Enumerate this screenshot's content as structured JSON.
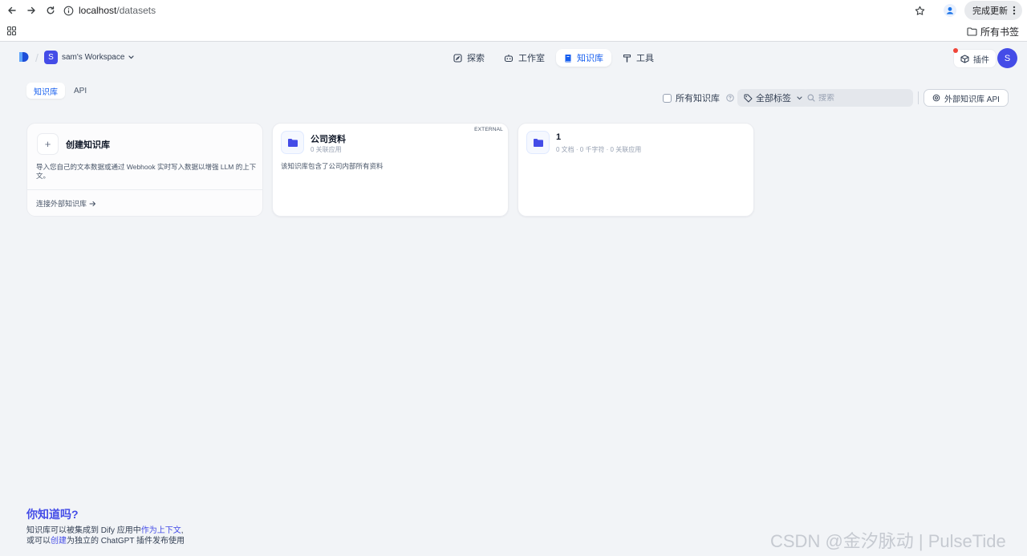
{
  "browser": {
    "url_host": "localhost",
    "url_path": "/datasets",
    "update_label": "完成更新",
    "bookmarks_label": "所有书签"
  },
  "header": {
    "workspace_initial": "S",
    "workspace_name": "sam's Workspace",
    "nav": [
      {
        "label": "探索",
        "icon": "compass-icon"
      },
      {
        "label": "工作室",
        "icon": "robot-icon"
      },
      {
        "label": "知识库",
        "icon": "book-icon",
        "active": true
      },
      {
        "label": "工具",
        "icon": "hammer-icon"
      }
    ],
    "plugin_label": "插件",
    "user_initial": "S"
  },
  "subtabs": [
    {
      "label": "知识库",
      "active": true
    },
    {
      "label": "API",
      "active": false
    }
  ],
  "toolbar": {
    "all_datasets_label": "所有知识库",
    "tags_label": "全部标签",
    "search_placeholder": "搜索",
    "external_api_label": "外部知识库 API"
  },
  "create_card": {
    "title": "创建知识库",
    "description": "导入您自己的文本数据或通过 Webhook 实时写入数据以增强 LLM 的上下文。",
    "connect_label": "连接外部知识库"
  },
  "datasets": [
    {
      "name": "公司资料",
      "meta": "0 关联应用",
      "description": "该知识库包含了公司内部所有资料",
      "badge": "EXTERNAL"
    },
    {
      "name": "1",
      "meta": "0 文档 · 0 千字符 · 0 关联应用",
      "description": ""
    }
  ],
  "tips": {
    "title": "你知道吗?",
    "line1_prefix": "知识库可以被集成到 Dify 应用中",
    "line1_link": "作为上下文",
    "line1_suffix": ",",
    "line2_prefix": "或可以",
    "line2_link": "创建",
    "line2_suffix": "为独立的 ChatGPT 插件发布使用"
  },
  "watermark": "CSDN @金汐脉动 | PulseTide",
  "colors": {
    "accent": "#444ce7",
    "link": "#155eef",
    "background": "#f2f4f7"
  }
}
